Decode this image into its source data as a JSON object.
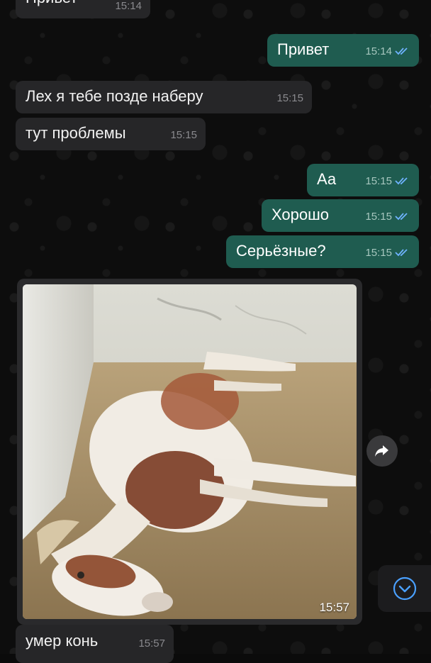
{
  "messages": [
    {
      "id": "m1",
      "direction": "in",
      "text": "Привет",
      "time": "15:14"
    },
    {
      "id": "m2",
      "direction": "out",
      "text": "Привет",
      "time": "15:14",
      "read": true
    },
    {
      "id": "m3",
      "direction": "in",
      "text": "Лех я тебе позде наберу",
      "time": "15:15"
    },
    {
      "id": "m4",
      "direction": "in",
      "text": "тут проблемы",
      "time": "15:15"
    },
    {
      "id": "m5",
      "direction": "out",
      "text": "Аа",
      "time": "15:15",
      "read": true
    },
    {
      "id": "m6",
      "direction": "out",
      "text": "Хорошо",
      "time": "15:15",
      "read": true
    },
    {
      "id": "m7",
      "direction": "out",
      "text": "Серьёзные?",
      "time": "15:15",
      "read": true
    },
    {
      "id": "m8",
      "direction": "in",
      "type": "photo",
      "time": "15:57"
    },
    {
      "id": "m9",
      "direction": "in",
      "text": "умер конь",
      "time": "15:57"
    }
  ],
  "icons": {
    "read_receipt": "double-check-icon",
    "forward": "forward-arrow-icon",
    "scroll_down": "chevron-down-circle-icon"
  },
  "colors": {
    "incoming_bubble": "#262628",
    "outgoing_bubble": "#1f5c50",
    "read_check": "#6fb3ff",
    "background": "#0d0d0d"
  }
}
